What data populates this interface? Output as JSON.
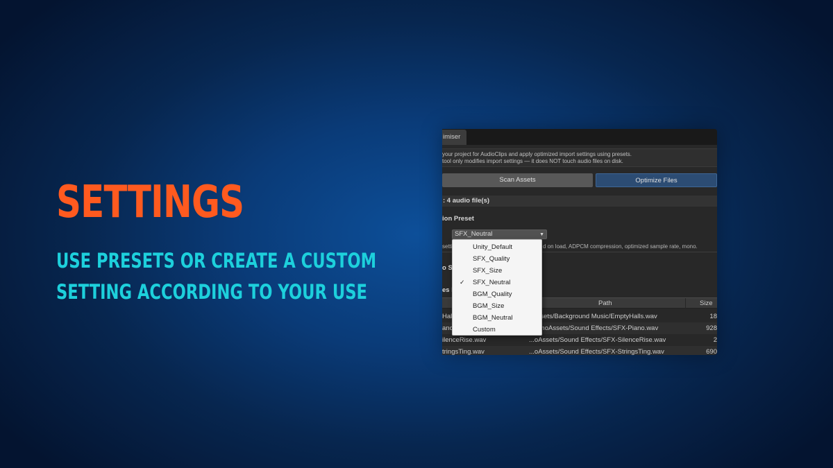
{
  "headline": "SETTINGS",
  "subline": [
    "USE PRESETS OR CREATE A CUSTOM",
    "SETTING ACCORDING TO YOUR USE"
  ],
  "colors": {
    "headline": "#ff5a1f",
    "subline": "#1dd0dc",
    "optimize_button": "#2c4c73"
  },
  "editor": {
    "tab_label": "imiser",
    "info_lines": [
      "your project for AudioClips and apply optimized import settings using presets.",
      "tool only modifies import settings — it does NOT touch audio files on disk."
    ],
    "scan_button": "Scan Assets",
    "optimize_button": "Optimize Files",
    "scan_result": ": 4 audio file(s)",
    "preset_section": "ion Preset",
    "preset_selected": "SFX_Neutral",
    "description_start": "settin",
    "description_end": "d on load, ADPCM compression, optimized sample rate, mono.",
    "label_o_s": "o S",
    "label_es_l": "es L",
    "table": {
      "columns": {
        "path": "Path",
        "size": "Size"
      },
      "rows": [
        {
          "name": "Hall",
          "path": "oAssets/Background Music/EmptyHalls.wav",
          "size": "18"
        },
        {
          "name": "ano",
          "path": "/DemoAssets/Sound Effects/SFX-Piano.wav",
          "size": "928"
        },
        {
          "name": "ilenceRise.wav",
          "path": "...oAssets/Sound Effects/SFX-SilenceRise.wav",
          "size": "2"
        },
        {
          "name": "tringsTing.wav",
          "path": "...oAssets/Sound Effects/SFX-StringsTing.wav",
          "size": "690"
        }
      ]
    },
    "dropdown_options": [
      {
        "label": "Unity_Default",
        "checked": false
      },
      {
        "label": "SFX_Quality",
        "checked": false
      },
      {
        "label": "SFX_Size",
        "checked": false
      },
      {
        "label": "SFX_Neutral",
        "checked": true
      },
      {
        "label": "BGM_Quality",
        "checked": false
      },
      {
        "label": "BGM_Size",
        "checked": false
      },
      {
        "label": "BGM_Neutral",
        "checked": false
      },
      {
        "label": "Custom",
        "checked": false
      }
    ],
    "check_glyph": "✓"
  }
}
